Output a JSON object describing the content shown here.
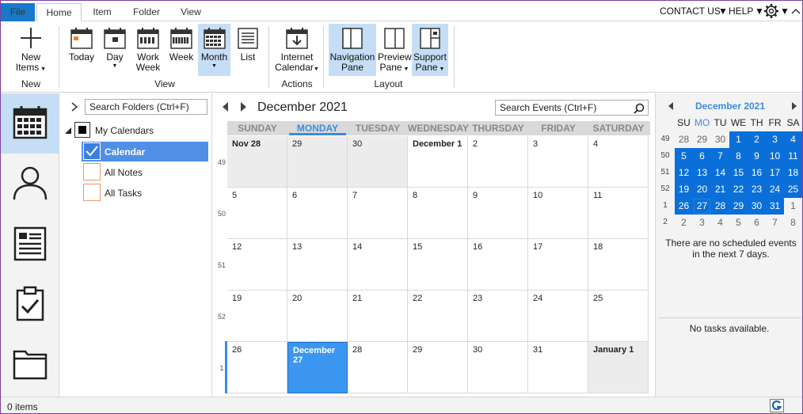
{
  "menu": {
    "file": "File",
    "tabs": [
      "Home",
      "Item",
      "Folder",
      "View"
    ],
    "contact": "CONTACT US",
    "help": "HELP"
  },
  "ribbon": {
    "new_items_1": "New",
    "new_items_2": "Items",
    "group_new": "New",
    "today": "Today",
    "day": "Day",
    "work_week_1": "Work",
    "work_week_2": "Week",
    "week": "Week",
    "month": "Month",
    "list": "List",
    "group_view": "View",
    "internet_1": "Internet",
    "internet_2": "Calendar",
    "group_actions": "Actions",
    "nav_1": "Navigation",
    "nav_2": "Pane",
    "preview_1": "Preview",
    "preview_2": "Pane",
    "support_1": "Support",
    "support_2": "Pane",
    "group_layout": "Layout"
  },
  "folders": {
    "search_placeholder": "Search Folders (Ctrl+F)",
    "root": "My Calendars",
    "items": [
      "Calendar",
      "All Notes",
      "All Tasks"
    ]
  },
  "calendar": {
    "title": "December 2021",
    "search_placeholder": "Search Events (Ctrl+F)",
    "day_headers": [
      "SUNDAY",
      "MONDAY",
      "TUESDAY",
      "WEDNESDAY",
      "THURSDAY",
      "FRIDAY",
      "SATURDAY"
    ],
    "week_numbers": [
      "49",
      "50",
      "51",
      "52",
      "1"
    ],
    "weeks": [
      [
        "Nov 28",
        "29",
        "30",
        "December 1",
        "2",
        "3",
        "4"
      ],
      [
        "5",
        "6",
        "7",
        "8",
        "9",
        "10",
        "11"
      ],
      [
        "12",
        "13",
        "14",
        "15",
        "16",
        "17",
        "18"
      ],
      [
        "19",
        "20",
        "21",
        "22",
        "23",
        "24",
        "25"
      ],
      [
        "26",
        "December 27",
        "28",
        "29",
        "30",
        "31",
        "January 1"
      ]
    ]
  },
  "mini": {
    "title": "December 2021",
    "day_headers": [
      "SU",
      "MO",
      "TU",
      "WE",
      "TH",
      "FR",
      "SA"
    ],
    "week_numbers": [
      "49",
      "50",
      "51",
      "52",
      "1",
      "2"
    ],
    "weeks": [
      [
        "28",
        "29",
        "30",
        "1",
        "2",
        "3",
        "4"
      ],
      [
        "5",
        "6",
        "7",
        "8",
        "9",
        "10",
        "11"
      ],
      [
        "12",
        "13",
        "14",
        "15",
        "16",
        "17",
        "18"
      ],
      [
        "19",
        "20",
        "21",
        "22",
        "23",
        "24",
        "25"
      ],
      [
        "26",
        "27",
        "28",
        "29",
        "30",
        "31",
        "1"
      ],
      [
        "2",
        "3",
        "4",
        "5",
        "6",
        "7",
        "8"
      ]
    ],
    "events_msg": "There are no scheduled events in the next 7 days.",
    "tasks_msg": "No tasks available."
  },
  "status": {
    "items": "0 items"
  },
  "colors": {
    "accent": "#1979ca",
    "selected": "#c5def5",
    "today": "#3b96f0",
    "mini_highlight": "#0a6fd8"
  }
}
